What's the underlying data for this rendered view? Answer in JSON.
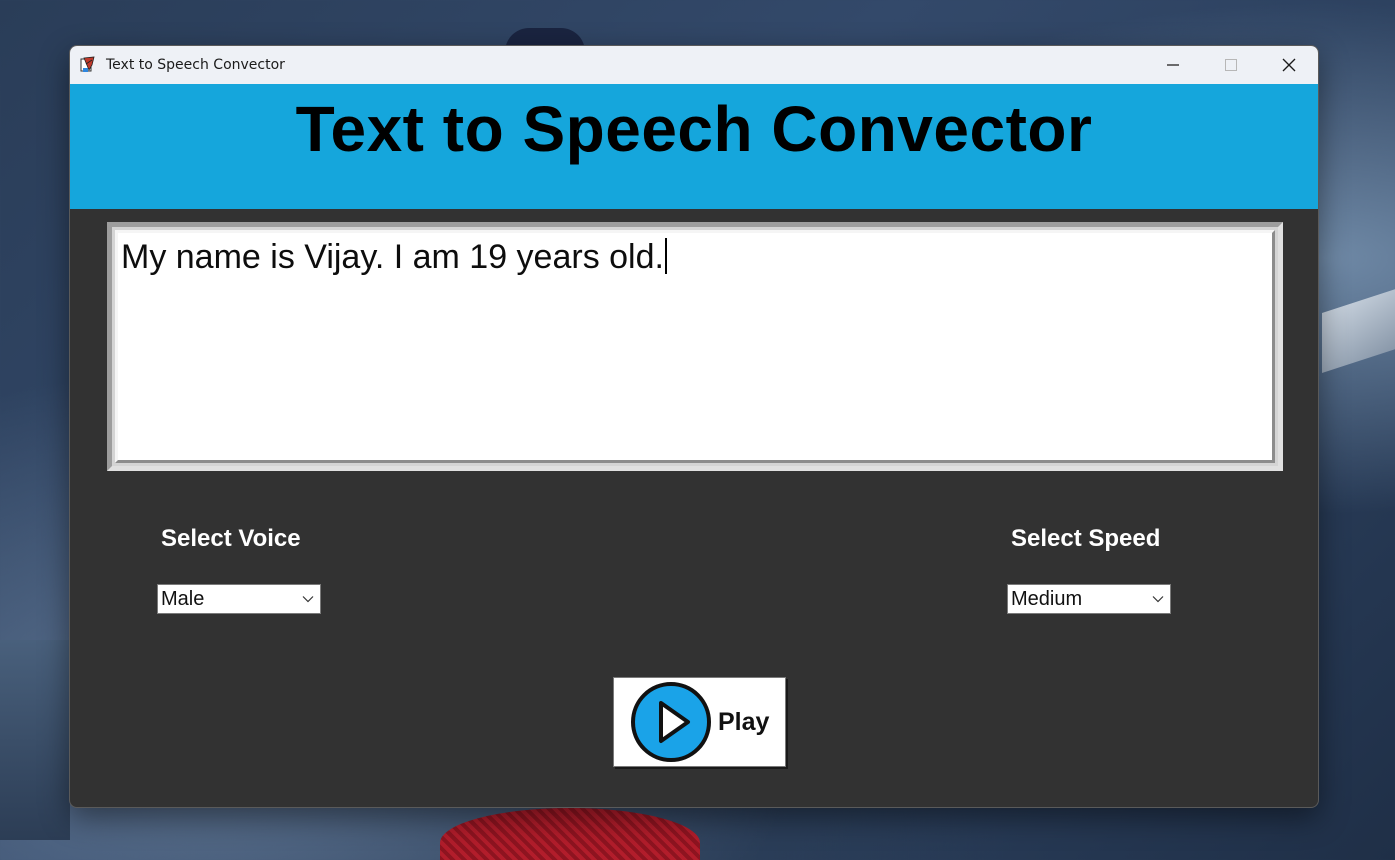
{
  "window": {
    "title": "Text to Speech Convector",
    "controls": {
      "minimize": "—",
      "maximize": "□",
      "close": "✕"
    }
  },
  "header": {
    "title": "Text to Speech Convector",
    "background_color": "#15a6dc"
  },
  "text_input": {
    "value": "My name is Vijay. I am 19 years old."
  },
  "voice": {
    "label": "Select Voice",
    "selected": "Male"
  },
  "speed": {
    "label": "Select Speed",
    "selected": "Medium"
  },
  "play_button": {
    "label": "Play",
    "icon": "play-circle-icon",
    "icon_color": "#1aa3e8"
  },
  "colors": {
    "panel_background": "#323232",
    "label_text": "#ffffff"
  }
}
